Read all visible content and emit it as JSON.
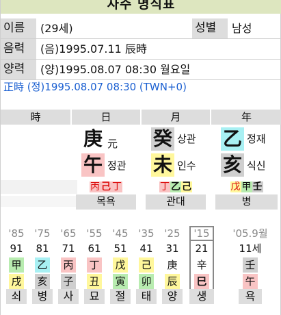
{
  "title": "사주 명식표",
  "info": {
    "name_label": "이름",
    "name_value": "(29세)",
    "gender_label": "성별",
    "gender_value": "남성",
    "lunar_label": "음력",
    "lunar_value": "(음)1995.07.11 辰時",
    "solar_label": "양력",
    "solar_value": "(양)1995.08.07 08:30 월요일",
    "correction": "正時 (정)1995.08.07 08:30 (TWN+0)"
  },
  "pillars": {
    "headers": [
      "時",
      "日",
      "月",
      "年"
    ],
    "stems": [
      {
        "char": "",
        "god": ""
      },
      {
        "char": "庚",
        "god": "元"
      },
      {
        "char": "癸",
        "god": "상관"
      },
      {
        "char": "乙",
        "god": "정재"
      }
    ],
    "branches": [
      {
        "char": "",
        "god": ""
      },
      {
        "char": "午",
        "god": "정관"
      },
      {
        "char": "未",
        "god": "인수"
      },
      {
        "char": "亥",
        "god": "식신"
      }
    ],
    "jijanggan": [
      [],
      [
        "丙",
        "己",
        "丁"
      ],
      [
        "丁",
        "乙",
        "己"
      ],
      [
        "戊",
        "甲",
        "壬"
      ]
    ],
    "unseong": [
      "",
      "목욕",
      "관대",
      "병"
    ]
  },
  "daewoon": {
    "years": [
      "'85",
      "'75",
      "'65",
      "'55",
      "'45",
      "'35",
      "'25",
      "'15",
      "'05.9월"
    ],
    "ages": [
      "91",
      "81",
      "71",
      "61",
      "51",
      "41",
      "31",
      "21",
      "11세"
    ],
    "stems": [
      "甲",
      "乙",
      "丙",
      "丁",
      "戊",
      "己",
      "庚",
      "辛",
      "壬"
    ],
    "branches": [
      "戌",
      "亥",
      "子",
      "丑",
      "寅",
      "卯",
      "辰",
      "巳",
      "午"
    ],
    "unseong": [
      "쇠",
      "병",
      "사",
      "묘",
      "절",
      "태",
      "양",
      "생",
      "욕"
    ]
  },
  "colors": {
    "wood": "#b8ecb0",
    "fire": "#f9c4c4",
    "earth": "#fff79c",
    "metal": "#ffffff",
    "water": "#cfcfcf",
    "correction_text": "#1a5fd1",
    "title_bg": "#dde6bf",
    "label_bg": "#dddddd"
  }
}
